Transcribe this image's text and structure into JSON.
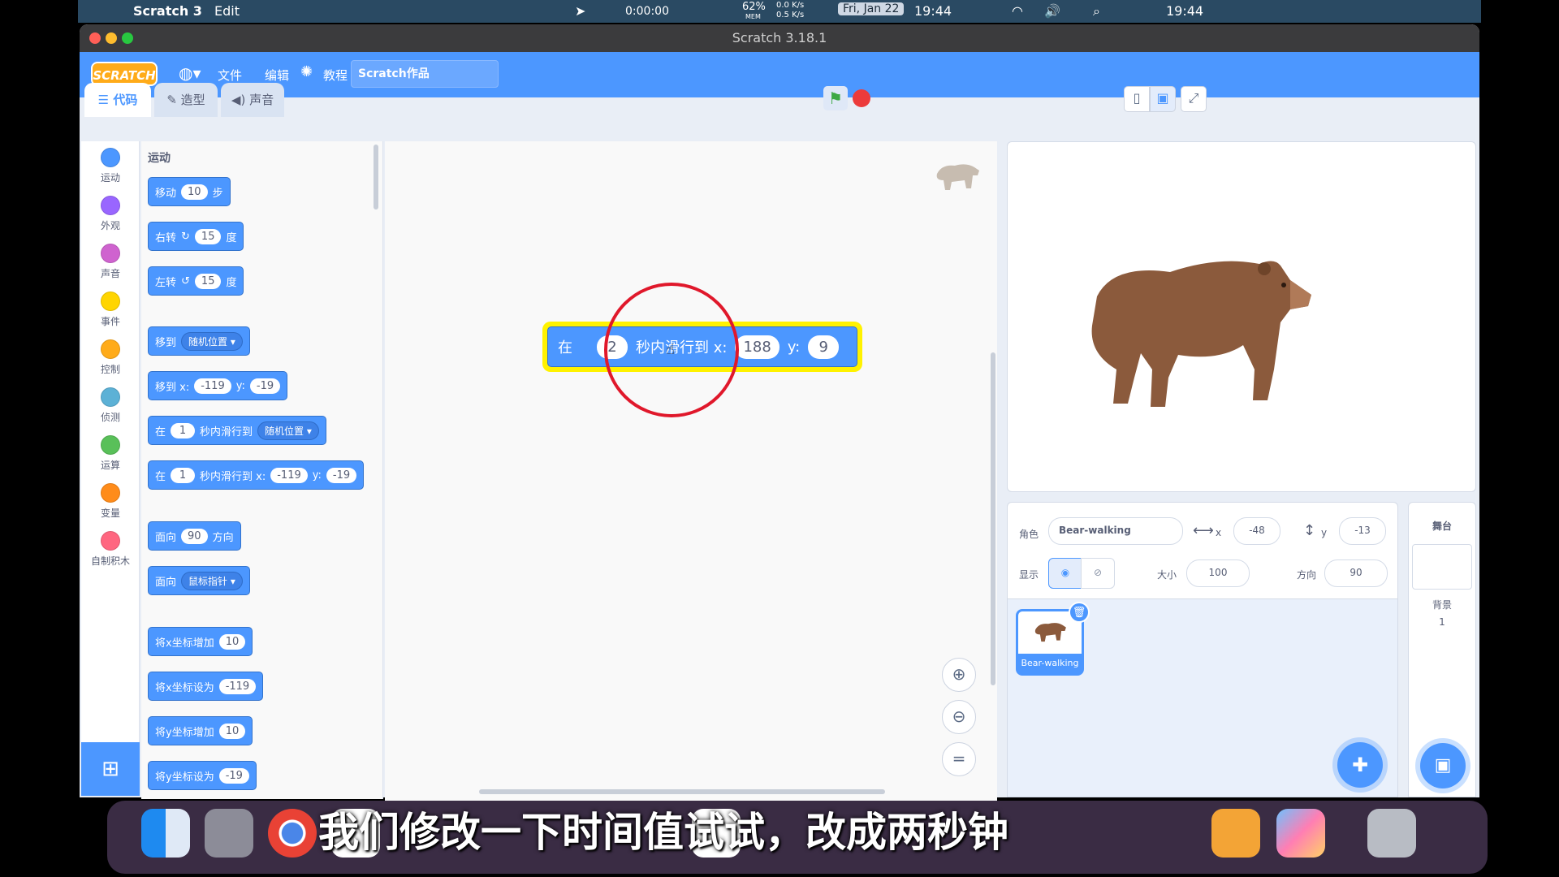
{
  "menubar": {
    "app": "Scratch 3",
    "edit": "Edit",
    "timer": "0:00:00",
    "mem": "62%",
    "mem_label": "MEM",
    "net": "0.0 K/s",
    "net2": "0.5 K/s",
    "date": "Fri, Jan 22",
    "time1": "19:44",
    "time2": "19:44"
  },
  "window": {
    "title": "Scratch 3.18.1"
  },
  "scratchbar": {
    "logo": "SCRATCH",
    "file": "文件",
    "edit": "编辑",
    "tutorial": "教程",
    "project_title": "Scratch作品"
  },
  "tabs": {
    "code": "代码",
    "costumes": "造型",
    "sounds": "声音"
  },
  "categories": [
    {
      "label": "运动",
      "color": "#4c97ff"
    },
    {
      "label": "外观",
      "color": "#9966ff"
    },
    {
      "label": "声音",
      "color": "#cf63cf"
    },
    {
      "label": "事件",
      "color": "#ffd500"
    },
    {
      "label": "控制",
      "color": "#ffab19"
    },
    {
      "label": "侦测",
      "color": "#5cb1d6"
    },
    {
      "label": "运算",
      "color": "#59c059"
    },
    {
      "label": "变量",
      "color": "#ff8c1a"
    },
    {
      "label": "自制积木",
      "color": "#ff6680"
    }
  ],
  "palette": {
    "heading": "运动",
    "move": {
      "a": "移动",
      "v": "10",
      "b": "步"
    },
    "turn_right": {
      "a": "右转",
      "v": "15",
      "b": "度"
    },
    "turn_left": {
      "a": "左转",
      "v": "15",
      "b": "度"
    },
    "goto": {
      "a": "移到",
      "d": "随机位置"
    },
    "goto_xy": {
      "a": "移到 x:",
      "x": "-119",
      "ylab": "y:",
      "y": "-19"
    },
    "glide_random": {
      "a": "在",
      "v": "1",
      "b": "秒内滑行到",
      "d": "随机位置"
    },
    "glide_xy": {
      "a": "在",
      "v": "1",
      "b": "秒内滑行到 x:",
      "x": "-119",
      "ylab": "y:",
      "y": "-19"
    },
    "point_dir": {
      "a": "面向",
      "v": "90",
      "b": "方向"
    },
    "point_towards": {
      "a": "面向",
      "d": "鼠标指针"
    },
    "change_x": {
      "a": "将x坐标增加",
      "v": "10"
    },
    "set_x": {
      "a": "将x坐标设为",
      "v": "-119"
    },
    "change_y": {
      "a": "将y坐标增加",
      "v": "10"
    },
    "set_y": {
      "a": "将y坐标设为",
      "v": "-19"
    }
  },
  "script": {
    "a": "在",
    "v": "2",
    "b": "秒内滑行到 x:",
    "x": "188",
    "ylab": "y:",
    "y": "9"
  },
  "sprite_info": {
    "sprite_label": "角色",
    "sprite_name": "Bear-walking",
    "x_label": "x",
    "x": "-48",
    "y_label": "y",
    "y": "-13",
    "show_label": "显示",
    "size_label": "大小",
    "size": "100",
    "dir_label": "方向",
    "dir": "90"
  },
  "sprite_list": [
    {
      "name": "Bear-walking"
    }
  ],
  "stage_panel": {
    "title": "舞台",
    "backdrop_label": "背景",
    "backdrop_count": "1"
  },
  "subtitle": "我们修改一下时间值试试，改成两秒钟"
}
